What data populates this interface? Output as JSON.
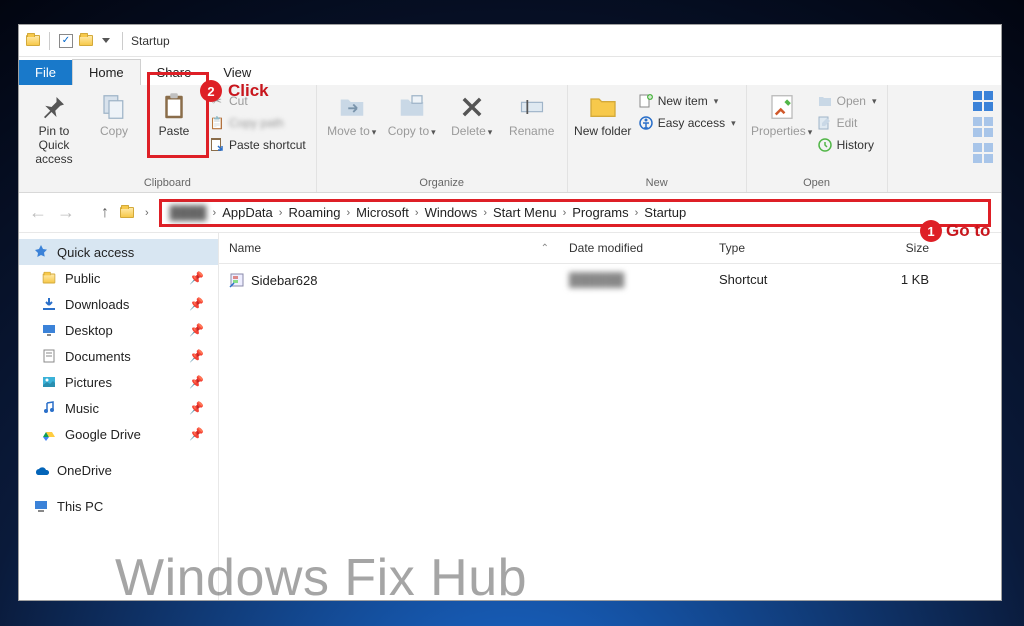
{
  "titlebar": {
    "title": "Startup"
  },
  "tabs": {
    "file": "File",
    "home": "Home",
    "share": "Share",
    "view": "View"
  },
  "ribbon": {
    "clipboard": {
      "label": "Clipboard",
      "pin": "Pin to Quick access",
      "copy": "Copy",
      "paste": "Paste",
      "cut": "Cut",
      "copy_path": "Copy path",
      "paste_shortcut": "Paste shortcut"
    },
    "organize": {
      "label": "Organize",
      "move_to": "Move to",
      "copy_to": "Copy to",
      "delete": "Delete",
      "rename": "Rename"
    },
    "new": {
      "label": "New",
      "new_folder": "New folder",
      "new_item": "New item",
      "easy_access": "Easy access"
    },
    "open": {
      "label": "Open",
      "properties": "Properties",
      "open": "Open",
      "edit": "Edit",
      "history": "History"
    }
  },
  "breadcrumb": {
    "items": [
      "",
      "AppData",
      "Roaming",
      "Microsoft",
      "Windows",
      "Start Menu",
      "Programs",
      "Startup"
    ]
  },
  "columns": {
    "name": "Name",
    "date": "Date modified",
    "type": "Type",
    "size": "Size"
  },
  "files": [
    {
      "name": "Sidebar628",
      "date": "",
      "type": "Shortcut",
      "size": "1 KB"
    }
  ],
  "sidebar": {
    "quick_access": "Quick access",
    "items": [
      {
        "label": "Public",
        "pinned": true,
        "icon": "folder"
      },
      {
        "label": "Downloads",
        "pinned": true,
        "icon": "downloads"
      },
      {
        "label": "Desktop",
        "pinned": true,
        "icon": "desktop"
      },
      {
        "label": "Documents",
        "pinned": true,
        "icon": "documents"
      },
      {
        "label": "Pictures",
        "pinned": true,
        "icon": "pictures"
      },
      {
        "label": "Music",
        "pinned": true,
        "icon": "music"
      },
      {
        "label": "Google Drive",
        "pinned": true,
        "icon": "gdrive"
      }
    ],
    "onedrive": "OneDrive",
    "this_pc": "This PC"
  },
  "annotations": {
    "step1": "Go to",
    "step2": "Click",
    "badge1": "1",
    "badge2": "2"
  },
  "watermark": "Windows Fix Hub"
}
